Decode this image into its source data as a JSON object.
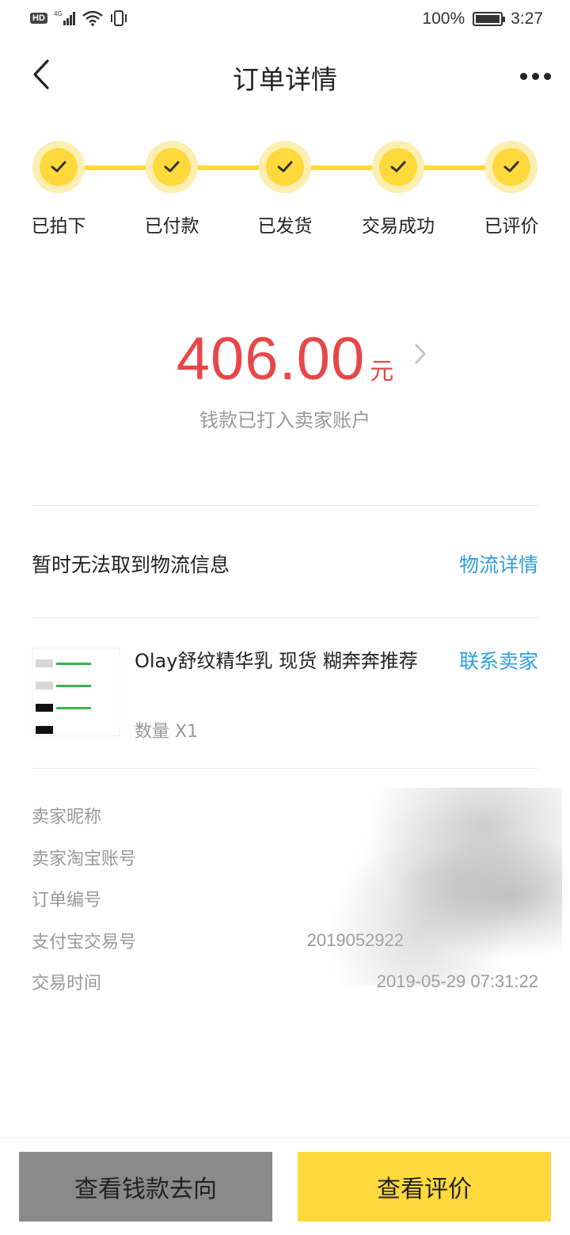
{
  "status_bar": {
    "network": "4G",
    "hd": "HD",
    "battery": "100%",
    "time": "3:27"
  },
  "header": {
    "title": "订单详情"
  },
  "steps": [
    {
      "label": "已拍下",
      "done": true
    },
    {
      "label": "已付款",
      "done": true
    },
    {
      "label": "已发货",
      "done": true
    },
    {
      "label": "交易成功",
      "done": true
    },
    {
      "label": "已评价",
      "done": true
    }
  ],
  "amount": {
    "value": "406.00",
    "unit": "元",
    "subtitle": "钱款已打入卖家账户"
  },
  "logistics": {
    "text": "暂时无法取到物流信息",
    "link": "物流详情"
  },
  "product": {
    "title": "Olay舒纹精华乳 现货 糊奔奔推荐",
    "quantity": "数量 X1",
    "contact": "联系卖家"
  },
  "info": [
    {
      "label": "卖家昵称",
      "value": ""
    },
    {
      "label": "卖家淘宝账号",
      "value": ""
    },
    {
      "label": "订单编号",
      "value": ""
    },
    {
      "label": "支付宝交易号",
      "value": "2019052922"
    },
    {
      "label": "交易时间",
      "value": "2019-05-29 07:31:22"
    }
  ],
  "buttons": {
    "money_flow": "查看钱款去向",
    "view_review": "查看评价"
  },
  "colors": {
    "accent_yellow": "#ffd93b",
    "price_red": "#e8474a",
    "link_blue": "#2f9fde"
  }
}
